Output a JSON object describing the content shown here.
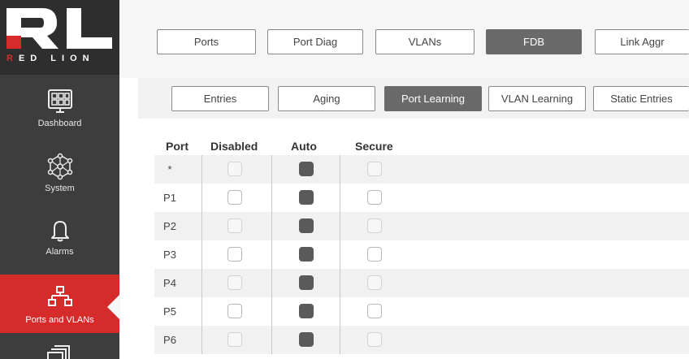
{
  "brand": {
    "logo_letters": "RL",
    "logo_word": "RED LION",
    "colors": {
      "brand_red": "#d62b2b",
      "sidebar": "#3d3d3d"
    }
  },
  "sidebar": {
    "items": [
      {
        "label": "Dashboard",
        "icon": "dashboard-icon"
      },
      {
        "label": "System",
        "icon": "system-network-icon"
      },
      {
        "label": "Alarms",
        "icon": "bell-icon"
      },
      {
        "label": "Ports and VLANs",
        "icon": "ports-network-icon",
        "active": true
      },
      {
        "label": "",
        "icon": "stacked-pages-icon"
      }
    ]
  },
  "top_tabs": [
    {
      "label": "Ports"
    },
    {
      "label": "Port Diag"
    },
    {
      "label": "VLANs"
    },
    {
      "label": "FDB",
      "active": true
    },
    {
      "label": "Link Aggr"
    }
  ],
  "sub_tabs": [
    {
      "label": "Entries"
    },
    {
      "label": "Aging"
    },
    {
      "label": "Port Learning",
      "active": true
    },
    {
      "label": "VLAN Learning"
    },
    {
      "label": "Static Entries"
    }
  ],
  "table": {
    "headers": {
      "port": "Port",
      "disabled": "Disabled",
      "auto": "Auto",
      "secure": "Secure"
    },
    "rows": [
      {
        "port": "*",
        "disabled": false,
        "auto": true,
        "secure": false
      },
      {
        "port": "P1",
        "disabled": false,
        "auto": true,
        "secure": false
      },
      {
        "port": "P2",
        "disabled": false,
        "auto": true,
        "secure": false
      },
      {
        "port": "P3",
        "disabled": false,
        "auto": true,
        "secure": false
      },
      {
        "port": "P4",
        "disabled": false,
        "auto": true,
        "secure": false
      },
      {
        "port": "P5",
        "disabled": false,
        "auto": true,
        "secure": false
      },
      {
        "port": "P6",
        "disabled": false,
        "auto": true,
        "secure": false
      }
    ]
  }
}
